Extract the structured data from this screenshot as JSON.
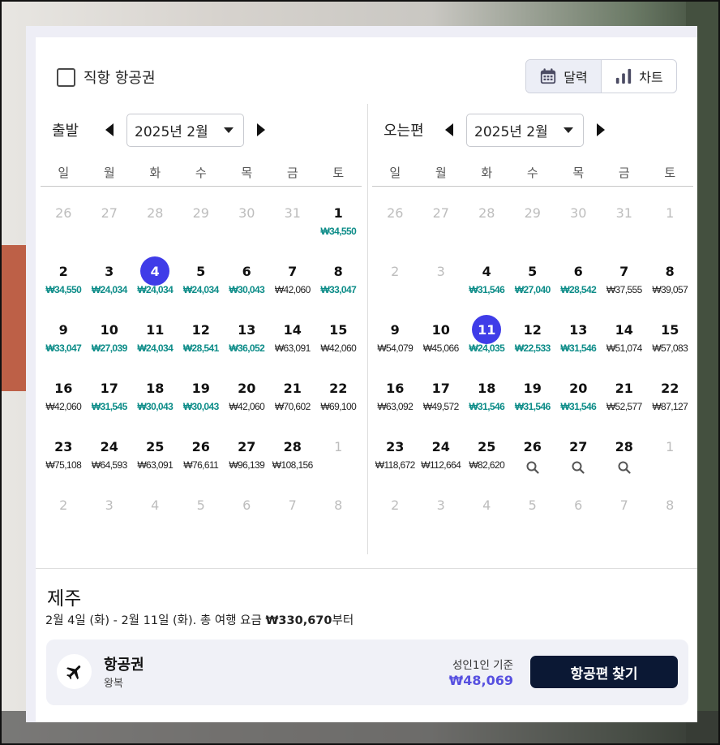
{
  "filters": {
    "direct_label": "직항 항공권"
  },
  "view_toggle": {
    "calendar_label": "달력",
    "chart_label": "차트"
  },
  "weekdays": [
    "일",
    "월",
    "화",
    "수",
    "목",
    "금",
    "토"
  ],
  "departure": {
    "title": "출발",
    "month": "2025년 2월",
    "rows": [
      [
        {
          "d": "26",
          "m": true
        },
        {
          "d": "27",
          "m": true
        },
        {
          "d": "28",
          "m": true
        },
        {
          "d": "29",
          "m": true
        },
        {
          "d": "30",
          "m": true
        },
        {
          "d": "31",
          "m": true
        },
        {
          "d": "1",
          "p": "₩34,550",
          "low": true
        }
      ],
      [
        {
          "d": "2",
          "p": "₩34,550",
          "low": true
        },
        {
          "d": "3",
          "p": "₩24,034",
          "low": true
        },
        {
          "d": "4",
          "p": "₩24,034",
          "low": true,
          "sel": true
        },
        {
          "d": "5",
          "p": "₩24,034",
          "low": true
        },
        {
          "d": "6",
          "p": "₩30,043",
          "low": true
        },
        {
          "d": "7",
          "p": "₩42,060"
        },
        {
          "d": "8",
          "p": "₩33,047",
          "low": true
        }
      ],
      [
        {
          "d": "9",
          "p": "₩33,047",
          "low": true
        },
        {
          "d": "10",
          "p": "₩27,039",
          "low": true
        },
        {
          "d": "11",
          "p": "₩24,034",
          "low": true
        },
        {
          "d": "12",
          "p": "₩28,541",
          "low": true
        },
        {
          "d": "13",
          "p": "₩36,052",
          "low": true
        },
        {
          "d": "14",
          "p": "₩63,091"
        },
        {
          "d": "15",
          "p": "₩42,060"
        }
      ],
      [
        {
          "d": "16",
          "p": "₩42,060"
        },
        {
          "d": "17",
          "p": "₩31,545",
          "low": true
        },
        {
          "d": "18",
          "p": "₩30,043",
          "low": true
        },
        {
          "d": "19",
          "p": "₩30,043",
          "low": true
        },
        {
          "d": "20",
          "p": "₩42,060"
        },
        {
          "d": "21",
          "p": "₩70,602"
        },
        {
          "d": "22",
          "p": "₩69,100"
        }
      ],
      [
        {
          "d": "23",
          "p": "₩75,108"
        },
        {
          "d": "24",
          "p": "₩64,593"
        },
        {
          "d": "25",
          "p": "₩63,091"
        },
        {
          "d": "26",
          "p": "₩76,611"
        },
        {
          "d": "27",
          "p": "₩96,139"
        },
        {
          "d": "28",
          "p": "₩108,156"
        },
        {
          "d": "1",
          "m": true
        }
      ],
      [
        {
          "d": "2",
          "m": true
        },
        {
          "d": "3",
          "m": true
        },
        {
          "d": "4",
          "m": true
        },
        {
          "d": "5",
          "m": true
        },
        {
          "d": "6",
          "m": true
        },
        {
          "d": "7",
          "m": true
        },
        {
          "d": "8",
          "m": true
        }
      ]
    ]
  },
  "return": {
    "title": "오는편",
    "month": "2025년 2월",
    "rows": [
      [
        {
          "d": "26",
          "m": true
        },
        {
          "d": "27",
          "m": true
        },
        {
          "d": "28",
          "m": true
        },
        {
          "d": "29",
          "m": true
        },
        {
          "d": "30",
          "m": true
        },
        {
          "d": "31",
          "m": true
        },
        {
          "d": "1",
          "m": true
        }
      ],
      [
        {
          "d": "2",
          "m": true
        },
        {
          "d": "3",
          "m": true
        },
        {
          "d": "4",
          "p": "₩31,546",
          "low": true
        },
        {
          "d": "5",
          "p": "₩27,040",
          "low": true
        },
        {
          "d": "6",
          "p": "₩28,542",
          "low": true
        },
        {
          "d": "7",
          "p": "₩37,555"
        },
        {
          "d": "8",
          "p": "₩39,057"
        }
      ],
      [
        {
          "d": "9",
          "p": "₩54,079"
        },
        {
          "d": "10",
          "p": "₩45,066"
        },
        {
          "d": "11",
          "p": "₩24,035",
          "low": true,
          "sel": true
        },
        {
          "d": "12",
          "p": "₩22,533",
          "low": true
        },
        {
          "d": "13",
          "p": "₩31,546",
          "low": true
        },
        {
          "d": "14",
          "p": "₩51,074"
        },
        {
          "d": "15",
          "p": "₩57,083"
        }
      ],
      [
        {
          "d": "16",
          "p": "₩63,092"
        },
        {
          "d": "17",
          "p": "₩49,572"
        },
        {
          "d": "18",
          "p": "₩31,546",
          "low": true
        },
        {
          "d": "19",
          "p": "₩31,546",
          "low": true
        },
        {
          "d": "20",
          "p": "₩31,546",
          "low": true
        },
        {
          "d": "21",
          "p": "₩52,577"
        },
        {
          "d": "22",
          "p": "₩87,127"
        }
      ],
      [
        {
          "d": "23",
          "p": "₩118,672"
        },
        {
          "d": "24",
          "p": "₩112,664"
        },
        {
          "d": "25",
          "p": "₩82,620"
        },
        {
          "d": "26",
          "search": true
        },
        {
          "d": "27",
          "search": true
        },
        {
          "d": "28",
          "search": true
        },
        {
          "d": "1",
          "m": true
        }
      ],
      [
        {
          "d": "2",
          "m": true
        },
        {
          "d": "3",
          "m": true
        },
        {
          "d": "4",
          "m": true
        },
        {
          "d": "5",
          "m": true
        },
        {
          "d": "6",
          "m": true
        },
        {
          "d": "7",
          "m": true
        },
        {
          "d": "8",
          "m": true
        }
      ]
    ]
  },
  "destination": "제주",
  "summary": {
    "prefix": "2월 4일 (화) - 2월 11일 (화). 총 여행 요금 ",
    "total": "₩330,670",
    "suffix": "부터"
  },
  "card": {
    "title": "항공권",
    "subtitle": "왕복",
    "basis": "성인1인 기준",
    "price": "₩48,069",
    "button_label": "항공편 찾기"
  },
  "colors": {
    "accent": "#3f3ce8",
    "low_price": "#0c8c88",
    "button": "#0b1834",
    "card_price": "#5750e0"
  }
}
